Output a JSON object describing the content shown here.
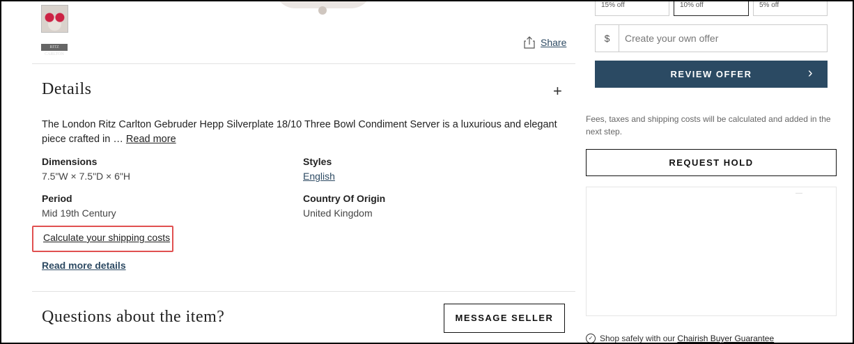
{
  "gallery": {
    "thumb_alt": "Condiment server thumbnail",
    "brand_thumb_text": "RITZ CARLTON"
  },
  "share": {
    "label": "Share",
    "icon": "share-icon"
  },
  "details": {
    "title": "Details",
    "description": "The London Ritz Carlton Gebruder Hepp Silverplate 18/10 Three Bowl Condiment Server is a luxurious and elegant piece crafted in … ",
    "read_more": "Read more",
    "specs": {
      "dimensions_label": "Dimensions",
      "dimensions_value": "7.5\"W × 7.5\"D × 6\"H",
      "styles_label": "Styles",
      "styles_value": "English",
      "period_label": "Period",
      "period_value": "Mid 19th Century",
      "origin_label": "Country Of Origin",
      "origin_value": "United Kingdom"
    },
    "shipping_link": "Calculate your shipping costs",
    "read_more_details": "Read more details"
  },
  "questions": {
    "title": "Questions about the item?",
    "message_button": "MESSAGE SELLER"
  },
  "offer": {
    "percent_options": [
      "15% off",
      "10% off",
      "5% off"
    ],
    "selected_index": 1,
    "currency": "$",
    "custom_placeholder": "Create your own offer",
    "review_button": "REVIEW OFFER",
    "fees_note": "Fees, taxes and shipping costs will be calculated and added in the next step.",
    "hold_button": "REQUEST HOLD",
    "guarantee_prefix": "Shop safely with our ",
    "guarantee_link": "Chairish Buyer Guarantee"
  },
  "colors": {
    "accent": "#2b4a63",
    "highlight_border": "#e05050"
  }
}
